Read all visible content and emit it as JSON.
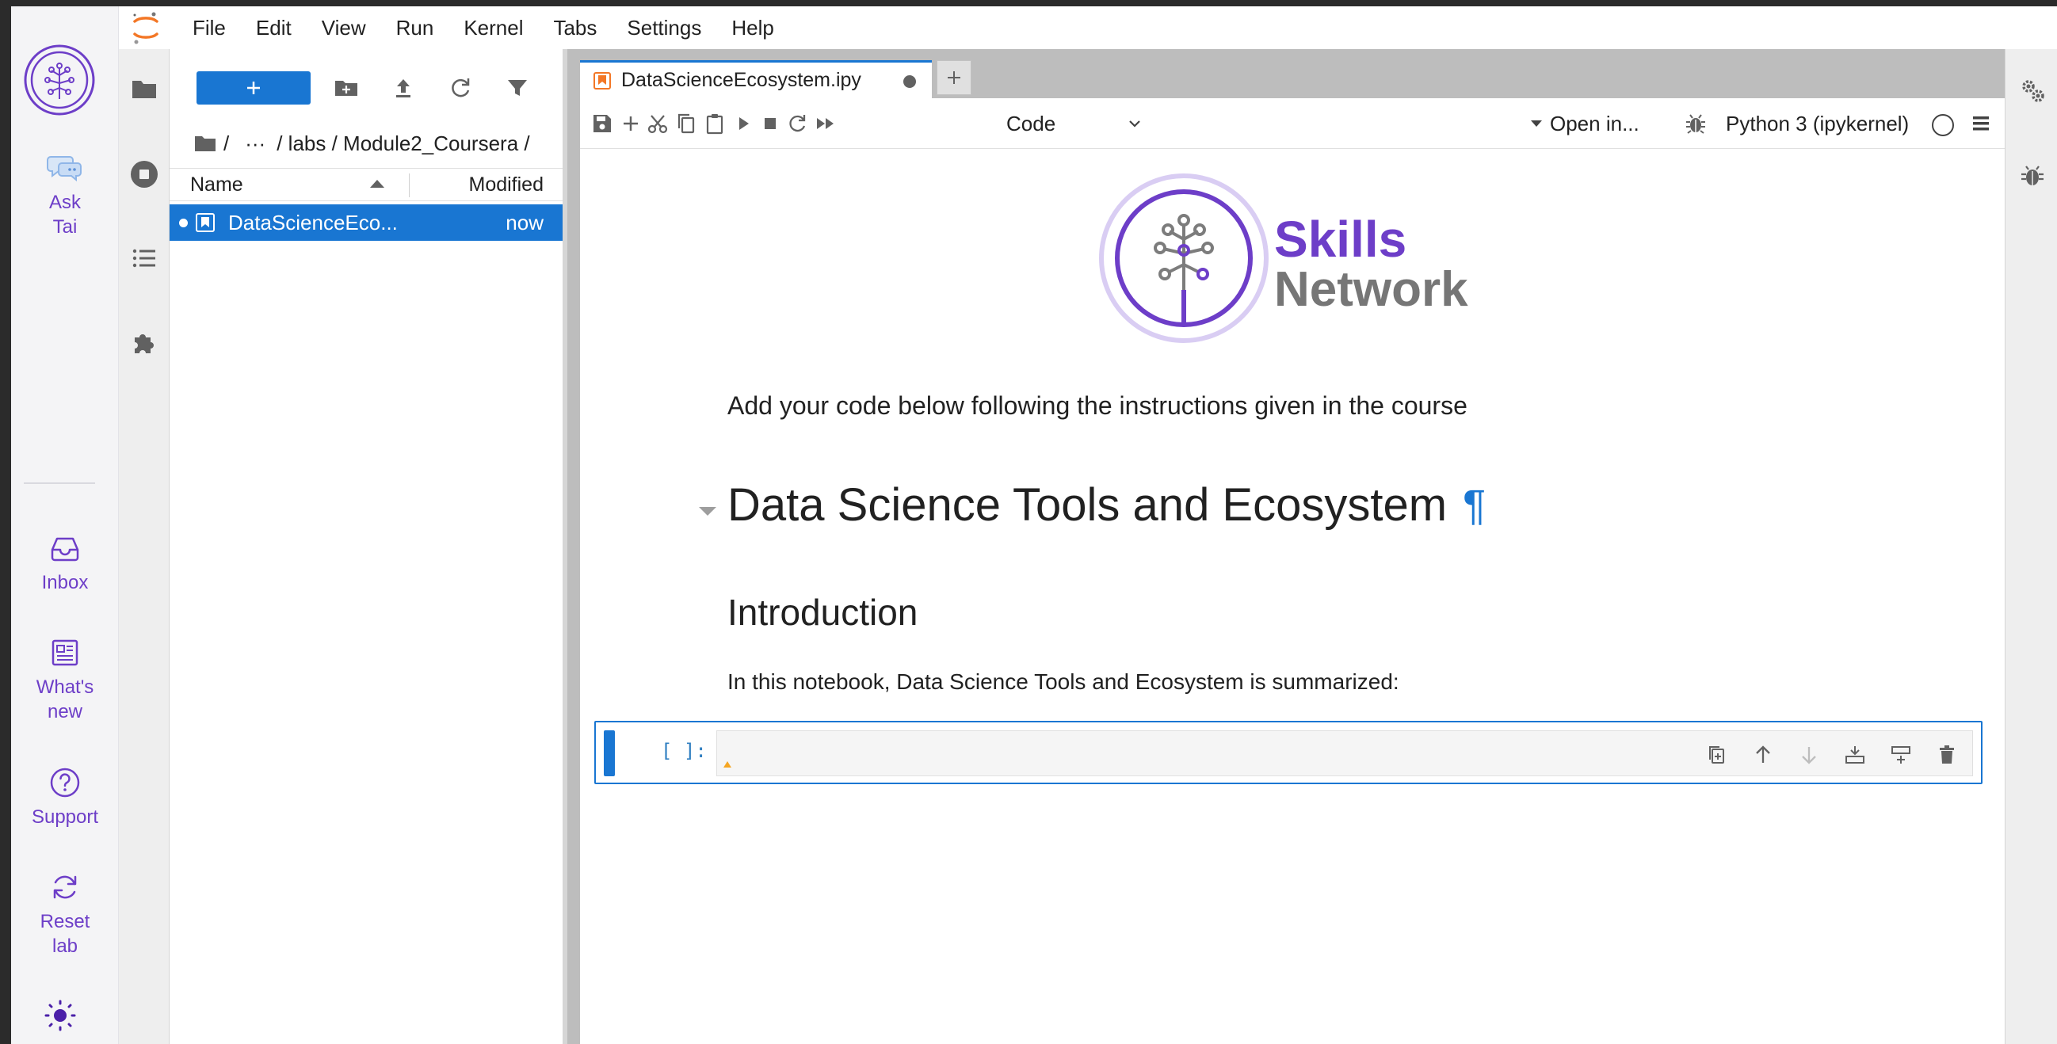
{
  "skills_rail": {
    "ask_tai": "Ask Tai",
    "inbox": "Inbox",
    "whats_new": "What's new",
    "support": "Support",
    "reset_lab": "Reset lab",
    "accent": "#6d3ec8"
  },
  "menubar": {
    "items": [
      "File",
      "Edit",
      "View",
      "Run",
      "Kernel",
      "Tabs",
      "Settings",
      "Help"
    ]
  },
  "filebrowser": {
    "breadcrumb": [
      "/",
      "···",
      "/ labs / Module2_Coursera /"
    ],
    "header_name": "Name",
    "header_modified": "Modified",
    "files": [
      {
        "name": "DataScienceEco...",
        "modified": "now"
      }
    ]
  },
  "tab": {
    "title": "DataScienceEcosystem.ipy"
  },
  "toolbar": {
    "cell_type": "Code",
    "open_in": "Open in...",
    "kernel": "Python 3 (ipykernel)"
  },
  "notebook": {
    "logo_word1": "Skills",
    "logo_word2": "Network",
    "instruction": "Add your code below following the instructions given in the course",
    "h1": "Data Science Tools and Ecosystem",
    "pilcrow": "¶",
    "h2": "Introduction",
    "paragraph": "In this notebook, Data Science Tools and Ecosystem is summarized:",
    "code_prompt": "[ ]:"
  },
  "colors": {
    "jupyter_blue": "#1976d2",
    "skills_purple": "#6d3ec8"
  }
}
